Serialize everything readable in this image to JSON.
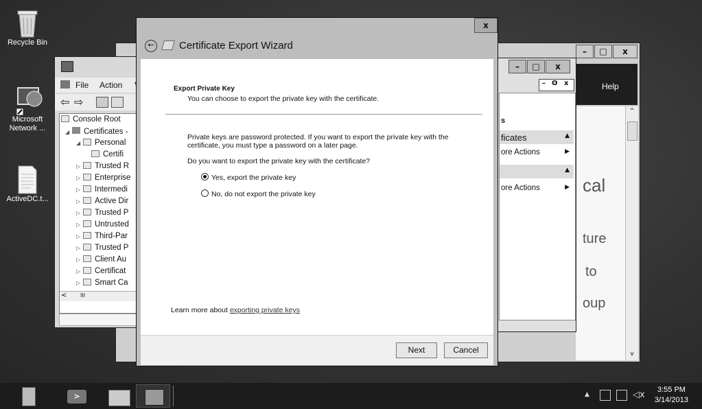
{
  "desktop": {
    "icons": [
      {
        "label": "Recycle Bin"
      },
      {
        "label": "Microsoft Network ..."
      },
      {
        "label": "ActiveDC.t..."
      }
    ]
  },
  "mmc": {
    "menu": {
      "file": "File",
      "action": "Action"
    },
    "tree": [
      {
        "label": "Console Root"
      },
      {
        "label": "Certificates -"
      },
      {
        "label": "Personal"
      },
      {
        "label": "Certifi"
      },
      {
        "label": "Trusted R"
      },
      {
        "label": "Enterprise"
      },
      {
        "label": "Intermedi"
      },
      {
        "label": "Active Dir"
      },
      {
        "label": "Trusted P"
      },
      {
        "label": "Untrusted"
      },
      {
        "label": "Third-Par"
      },
      {
        "label": "Trusted P"
      },
      {
        "label": "Client Au"
      },
      {
        "label": "Certificat"
      },
      {
        "label": "Smart Ca"
      }
    ],
    "scroll_glyph": "III"
  },
  "actions_pane": {
    "header": "s",
    "section1": "ficates",
    "more_actions_1": "ore Actions",
    "more_actions_2": "ore Actions"
  },
  "back_window": {
    "help": "Help",
    "frag1": "cal",
    "frag2": "ture",
    "frag3": "to",
    "frag4": "oup"
  },
  "wizard": {
    "title": "Certificate Export Wizard",
    "close": "x",
    "heading": "Export Private Key",
    "subheading": "You can choose to export the private key with the certificate.",
    "para_line1": "Private keys are password protected. If you want to export the private key with the",
    "para_line2": "certificate, you must type a password on a later page.",
    "question": "Do you want to export the private key with the certificate?",
    "option_yes": "Yes, export the private key",
    "option_no": "No, do not export the private key",
    "learn_prefix": "Learn more about ",
    "learn_link": "exporting private keys",
    "next": "Next",
    "cancel": "Cancel"
  },
  "taskbar": {
    "time": "3:55 PM",
    "date": "3/14/2013"
  }
}
